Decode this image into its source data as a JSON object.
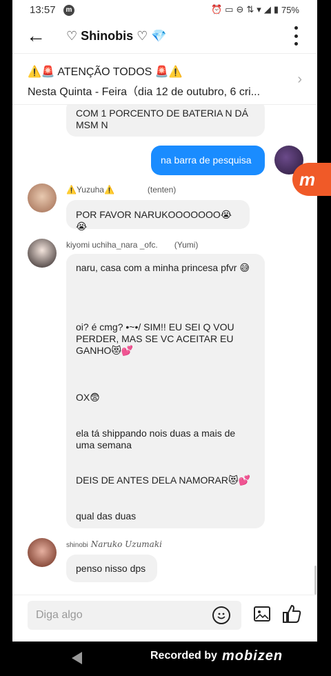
{
  "status": {
    "time": "13:57",
    "battery": "75%"
  },
  "header": {
    "title": "♡ Shinobis ♡ 💎"
  },
  "announcement": {
    "headline": "⚠️🚨 ATENÇÃO TODOS 🚨⚠️",
    "subtitle": "Nesta Quinta - Feira（dia 12 de outubro, 6 cri..."
  },
  "messages": [
    {
      "type": "in",
      "text": "COM 1 PORCENTO DE BATERIA N DÁ MSM N"
    },
    {
      "type": "out",
      "text": "na barra de pesquisa"
    },
    {
      "type": "in",
      "name": "⚠️Yuzuha⚠️",
      "tag": "(tenten)",
      "text": "POR FAVOR NARUKOOOOOOO😭😭"
    },
    {
      "type": "in",
      "name": "kiyomi uchiha_nara _ofc.",
      "tag": "(Yumi)",
      "lines": [
        "naru, casa com a minha princesa pfvr 😅",
        "oi? é cmg? •~•/ SIM!! EU SEI Q VOU PERDER, MAS SE VC ACEITAR EU GANHO😻💕",
        "OX😨",
        "ela tá shippando nois duas a mais de uma semana",
        "DEIS DE ANTES DELA NAMORAR😻💕",
        "qual das duas"
      ]
    },
    {
      "type": "in",
      "name_prefix": "shinobi",
      "name": "Naruko Uzumaki",
      "text": "penso nisso dps"
    }
  ],
  "composer": {
    "placeholder": "Diga algo"
  },
  "navbar": {
    "recorded_label": "Recorded by",
    "brand": "mobizen"
  },
  "colors": {
    "accent": "#1a8cff",
    "bubble_bg": "#f1f1f1",
    "record_badge": "#f05a28"
  }
}
